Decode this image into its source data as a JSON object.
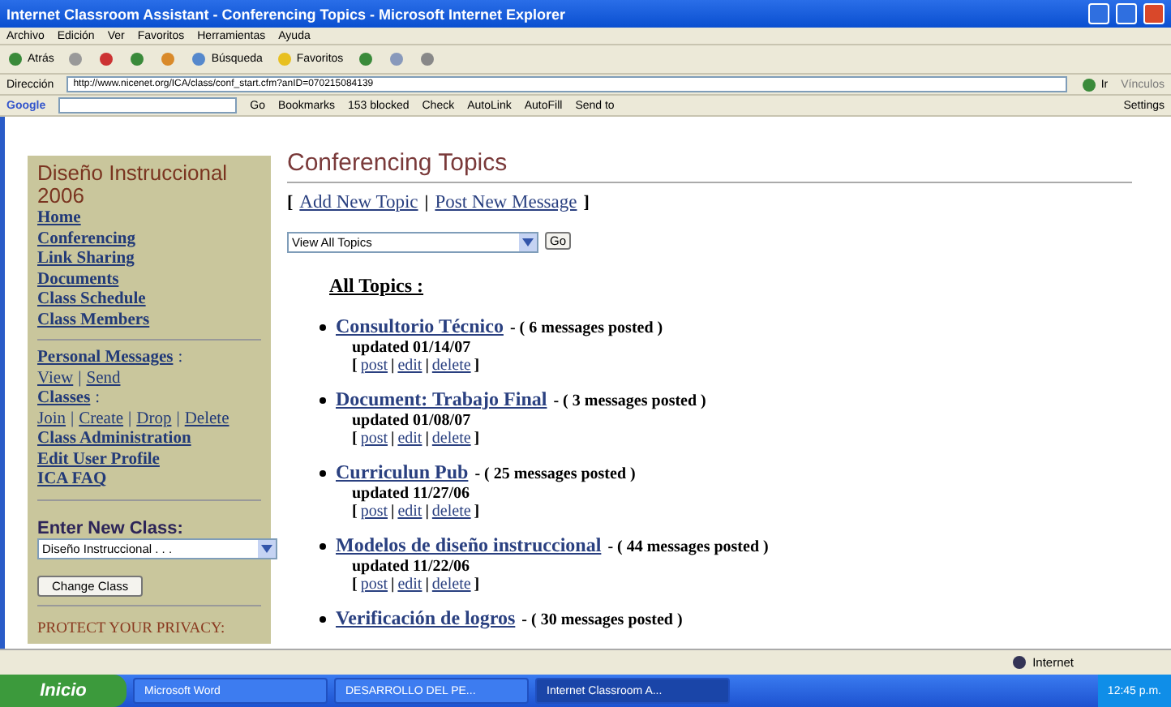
{
  "window": {
    "title": "Internet Classroom Assistant - Conferencing Topics - Microsoft Internet Explorer"
  },
  "menu": [
    "Archivo",
    "Edición",
    "Ver",
    "Favoritos",
    "Herramientas",
    "Ayuda"
  ],
  "toolbar": {
    "back": "Atrás",
    "search": "Búsqueda",
    "favorites": "Favoritos"
  },
  "address": {
    "label": "Dirección",
    "url": "http://www.nicenet.org/ICA/class/conf_start.cfm?anID=070215084139",
    "go": "Ir",
    "links": "Vínculos"
  },
  "google_bar": {
    "logo": "Google",
    "go": "Go",
    "items": [
      "Bookmarks",
      "153 blocked",
      "Check",
      "AutoLink",
      "AutoFill",
      "Send to"
    ],
    "settings": "Settings"
  },
  "sidebar": {
    "title": "Diseño Instruccional 2006",
    "links": [
      "Home",
      "Conferencing",
      "Link Sharing",
      "Documents",
      "Class Schedule",
      "Class Members"
    ],
    "personal_line": [
      {
        "kind": "link",
        "text": "Personal Messages"
      },
      {
        "kind": "text",
        "text": ":"
      }
    ],
    "personal_links": [
      {
        "kind": "link",
        "text": "View"
      },
      {
        "kind": "text",
        "text": "|"
      },
      {
        "kind": "link",
        "text": "Send"
      }
    ],
    "classes_line": [
      {
        "kind": "link",
        "text": "Classes"
      },
      {
        "kind": "text",
        "text": ":"
      }
    ],
    "classes_links": [
      {
        "kind": "link",
        "text": "Join"
      },
      {
        "kind": "text",
        "text": "|"
      },
      {
        "kind": "link",
        "text": "Create"
      },
      {
        "kind": "text",
        "text": "|"
      },
      {
        "kind": "link",
        "text": "Drop"
      },
      {
        "kind": "text",
        "text": "|"
      },
      {
        "kind": "link",
        "text": "Delete"
      }
    ],
    "admin_links": [
      "Class Administration",
      "Edit User Profile",
      "ICA FAQ"
    ],
    "enter_class": "Enter New Class:",
    "class_select": "Diseño Instruccional . . .",
    "change_button": "Change Class",
    "privacy": "PROTECT YOUR PRIVACY:"
  },
  "main": {
    "heading": "Conferencing Topics",
    "actions": [
      {
        "kind": "text",
        "text": "["
      },
      {
        "kind": "link",
        "text": "Add New Topic"
      },
      {
        "kind": "text",
        "text": "|"
      },
      {
        "kind": "link",
        "text": "Post New Message"
      },
      {
        "kind": "text",
        "text": "]"
      }
    ],
    "filter": "View All Topics",
    "go": "Go",
    "list_title": "All Topics :",
    "topics": [
      {
        "title": "Consultorio Técnico",
        "count": "- ( 6 messages posted )",
        "updated": "updated 01/14/07",
        "links": [
          {
            "kind": "text",
            "text": "["
          },
          {
            "kind": "link",
            "text": "post"
          },
          {
            "kind": "text",
            "text": "|"
          },
          {
            "kind": "link",
            "text": "edit"
          },
          {
            "kind": "text",
            "text": "|"
          },
          {
            "kind": "link",
            "text": "delete"
          },
          {
            "kind": "text",
            "text": "]"
          }
        ]
      },
      {
        "title": "Document: Trabajo Final",
        "count": "- ( 3 messages posted )",
        "updated": "updated 01/08/07",
        "links": [
          {
            "kind": "text",
            "text": "["
          },
          {
            "kind": "link",
            "text": "post"
          },
          {
            "kind": "text",
            "text": "|"
          },
          {
            "kind": "link",
            "text": "edit"
          },
          {
            "kind": "text",
            "text": "|"
          },
          {
            "kind": "link",
            "text": "delete"
          },
          {
            "kind": "text",
            "text": "]"
          }
        ]
      },
      {
        "title": "Curriculun Pub",
        "count": "- ( 25 messages posted )",
        "updated": "updated 11/27/06",
        "links": [
          {
            "kind": "text",
            "text": "["
          },
          {
            "kind": "link",
            "text": "post"
          },
          {
            "kind": "text",
            "text": "|"
          },
          {
            "kind": "link",
            "text": "edit"
          },
          {
            "kind": "text",
            "text": "|"
          },
          {
            "kind": "link",
            "text": "delete"
          },
          {
            "kind": "text",
            "text": "]"
          }
        ]
      },
      {
        "title": "Modelos de diseño instruccional",
        "count": "- ( 44 messages posted )",
        "updated": "updated 11/22/06",
        "links": [
          {
            "kind": "text",
            "text": "["
          },
          {
            "kind": "link",
            "text": "post"
          },
          {
            "kind": "text",
            "text": "|"
          },
          {
            "kind": "link",
            "text": "edit"
          },
          {
            "kind": "text",
            "text": "|"
          },
          {
            "kind": "link",
            "text": "delete"
          },
          {
            "kind": "text",
            "text": "]"
          }
        ]
      },
      {
        "title": "Verificación de logros",
        "count": "- ( 30 messages posted )"
      }
    ]
  },
  "status_bar": {
    "zone": "Internet"
  },
  "taskbar": {
    "start": "Inicio",
    "tasks": [
      {
        "label": "Microsoft Word",
        "selected": false
      },
      {
        "label": "DESARROLLO DEL PE...",
        "selected": false
      },
      {
        "label": "Internet Classroom A...",
        "selected": true
      }
    ],
    "clock": "12:45 p.m."
  }
}
